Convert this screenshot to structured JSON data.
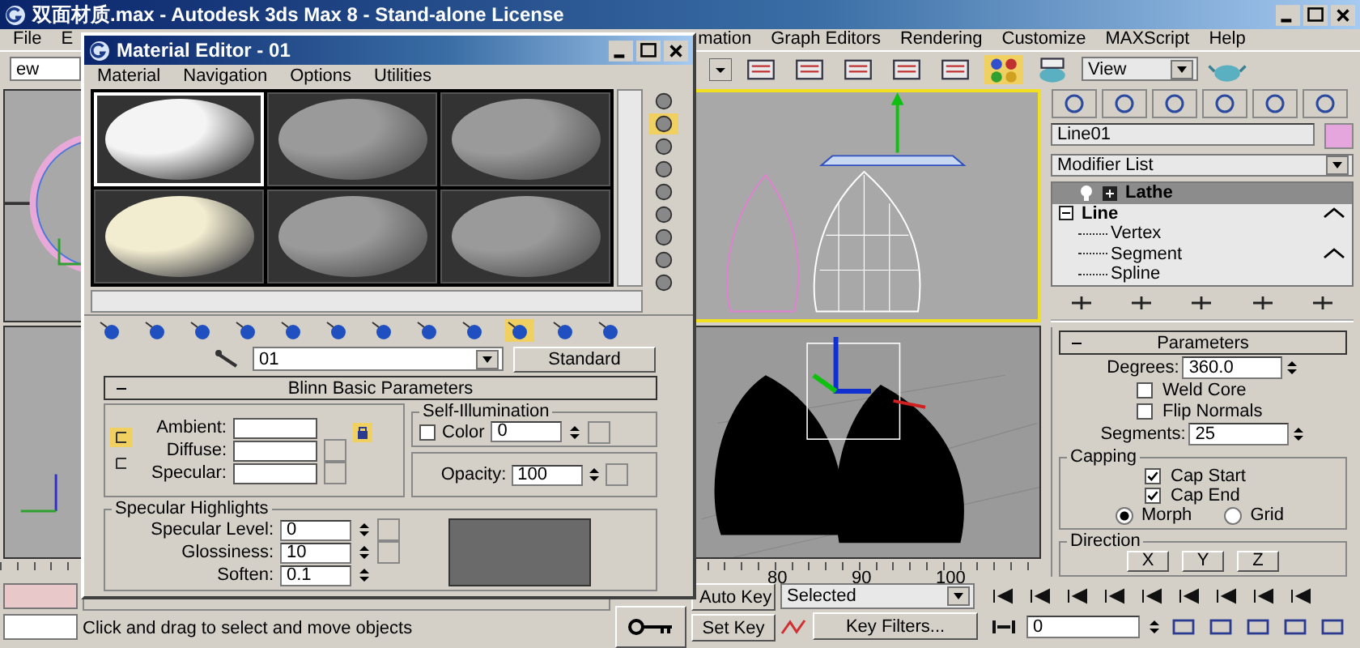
{
  "window": {
    "title": "双面材质.max - Autodesk 3ds Max 8  - Stand-alone License"
  },
  "menu_left": [
    "File",
    "E"
  ],
  "menu_right": [
    "mation",
    "Graph Editors",
    "Rendering",
    "Customize",
    "MAXScript",
    "Help"
  ],
  "toolbar": {
    "left_combo": "ew",
    "view_combo": "View"
  },
  "timeline": {
    "ticks": [
      "80",
      "90",
      "100"
    ]
  },
  "status_text": "Click and drag to select and move objects",
  "key_controls": {
    "auto_key": "Auto Key",
    "set_key": "Set Key",
    "key_mode": "Selected",
    "key_filters": "Key Filters...",
    "frame": "0"
  },
  "command_panel": {
    "object": {
      "name": "Line01",
      "color": "#e4a6dc"
    },
    "modifier_list": "Modifier List",
    "stack": [
      {
        "label": "Lathe",
        "selected": true,
        "expanded": false,
        "marked": false
      },
      {
        "label": "Line",
        "selected": false,
        "expanded": true,
        "marked": true,
        "children": [
          {
            "label": "Vertex",
            "marked": false
          },
          {
            "label": "Segment",
            "marked": true
          },
          {
            "label": "Spline",
            "marked": false
          }
        ]
      }
    ],
    "parameters": {
      "title": "Parameters",
      "degrees_label": "Degrees:",
      "degrees": "360.0",
      "options": [
        {
          "label": "Weld Core",
          "checked": false
        },
        {
          "label": "Flip Normals",
          "checked": false
        }
      ],
      "segments_label": "Segments:",
      "segments": "25",
      "capping": {
        "title": "Capping",
        "options": [
          {
            "label": "Cap Start",
            "checked": true
          },
          {
            "label": "Cap End",
            "checked": true
          }
        ],
        "modes": [
          {
            "label": "Morph",
            "selected": true
          },
          {
            "label": "Grid",
            "selected": false
          }
        ]
      },
      "direction": {
        "title": "Direction",
        "buttons": [
          "X",
          "Y",
          "Z"
        ]
      }
    }
  },
  "material_editor": {
    "title": "Material Editor - 01",
    "menu": [
      "Material",
      "Navigation",
      "Options",
      "Utilities"
    ],
    "slots": [
      {
        "color": "#f4f4f4",
        "selected": true
      },
      {
        "color": "#9a9a9a",
        "selected": false
      },
      {
        "color": "#9a9a9a",
        "selected": false
      },
      {
        "color": "#f2ecd0",
        "selected": false
      },
      {
        "color": "#9a9a9a",
        "selected": false
      },
      {
        "color": "#9a9a9a",
        "selected": false
      }
    ],
    "material_name": "01",
    "material_type": "Standard",
    "rollout": {
      "title": "Blinn Basic Parameters",
      "colors": [
        {
          "label": "Ambient:"
        },
        {
          "label": "Diffuse:"
        },
        {
          "label": "Specular:"
        }
      ],
      "self_illum": {
        "title": "Self-Illumination",
        "label": "Color",
        "checked": false,
        "value": "0"
      },
      "opacity": {
        "label": "Opacity:",
        "value": "100"
      },
      "highlights": {
        "title": "Specular Highlights",
        "fields": [
          {
            "label": "Specular Level:",
            "value": "0"
          },
          {
            "label": "Glossiness:",
            "value": "10"
          },
          {
            "label": "Soften:",
            "value": "0.1"
          }
        ]
      }
    }
  }
}
